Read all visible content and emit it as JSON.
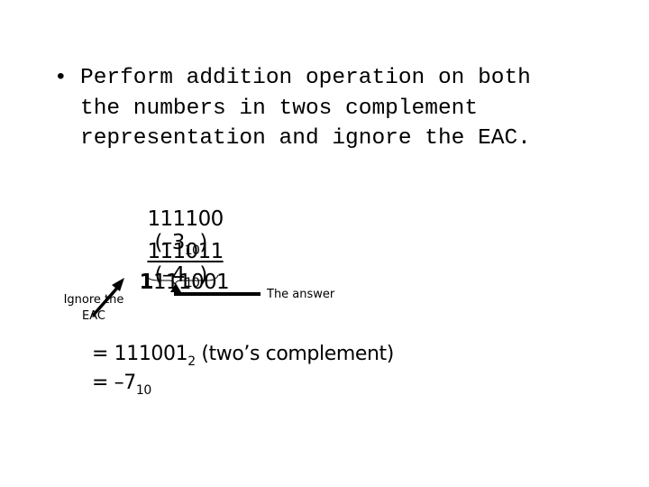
{
  "bullet": {
    "marker": "•",
    "lines": [
      "Perform addition operation on both",
      "the numbers in twos complement",
      "representation and ignore the EAC."
    ]
  },
  "calculation": {
    "operand1": {
      "bits": "111100",
      "paren_open": "(–3",
      "base": "10",
      "paren_close": ")"
    },
    "operand2": {
      "bits": "111011",
      "paren_open": "(–4",
      "base": "10",
      "paren_close": ")"
    },
    "sum": {
      "carry_bit": "1",
      "result_bits": "111001"
    }
  },
  "annotations": {
    "eac_label_line1": "Ignore the",
    "eac_label_line2": "EAC",
    "answer_label": "The answer"
  },
  "result": {
    "line1_prefix": "= 111001",
    "line1_base": "2",
    "line1_suffix": " (two’s complement)",
    "line2_prefix": "= –7",
    "line2_base": "10"
  }
}
